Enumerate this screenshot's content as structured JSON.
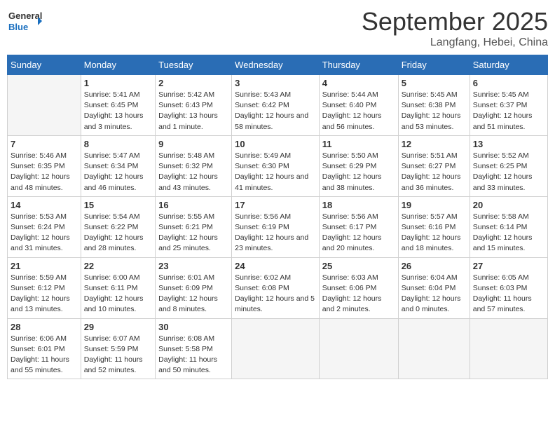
{
  "logo": {
    "text_general": "General",
    "text_blue": "Blue"
  },
  "title": "September 2025",
  "subtitle": "Langfang, Hebei, China",
  "weekdays": [
    "Sunday",
    "Monday",
    "Tuesday",
    "Wednesday",
    "Thursday",
    "Friday",
    "Saturday"
  ],
  "weeks": [
    [
      {
        "day": "",
        "info": ""
      },
      {
        "day": "1",
        "info": "Sunrise: 5:41 AM\nSunset: 6:45 PM\nDaylight: 13 hours\nand 3 minutes."
      },
      {
        "day": "2",
        "info": "Sunrise: 5:42 AM\nSunset: 6:43 PM\nDaylight: 13 hours\nand 1 minute."
      },
      {
        "day": "3",
        "info": "Sunrise: 5:43 AM\nSunset: 6:42 PM\nDaylight: 12 hours\nand 58 minutes."
      },
      {
        "day": "4",
        "info": "Sunrise: 5:44 AM\nSunset: 6:40 PM\nDaylight: 12 hours\nand 56 minutes."
      },
      {
        "day": "5",
        "info": "Sunrise: 5:45 AM\nSunset: 6:38 PM\nDaylight: 12 hours\nand 53 minutes."
      },
      {
        "day": "6",
        "info": "Sunrise: 5:45 AM\nSunset: 6:37 PM\nDaylight: 12 hours\nand 51 minutes."
      }
    ],
    [
      {
        "day": "7",
        "info": "Sunrise: 5:46 AM\nSunset: 6:35 PM\nDaylight: 12 hours\nand 48 minutes."
      },
      {
        "day": "8",
        "info": "Sunrise: 5:47 AM\nSunset: 6:34 PM\nDaylight: 12 hours\nand 46 minutes."
      },
      {
        "day": "9",
        "info": "Sunrise: 5:48 AM\nSunset: 6:32 PM\nDaylight: 12 hours\nand 43 minutes."
      },
      {
        "day": "10",
        "info": "Sunrise: 5:49 AM\nSunset: 6:30 PM\nDaylight: 12 hours\nand 41 minutes."
      },
      {
        "day": "11",
        "info": "Sunrise: 5:50 AM\nSunset: 6:29 PM\nDaylight: 12 hours\nand 38 minutes."
      },
      {
        "day": "12",
        "info": "Sunrise: 5:51 AM\nSunset: 6:27 PM\nDaylight: 12 hours\nand 36 minutes."
      },
      {
        "day": "13",
        "info": "Sunrise: 5:52 AM\nSunset: 6:25 PM\nDaylight: 12 hours\nand 33 minutes."
      }
    ],
    [
      {
        "day": "14",
        "info": "Sunrise: 5:53 AM\nSunset: 6:24 PM\nDaylight: 12 hours\nand 31 minutes."
      },
      {
        "day": "15",
        "info": "Sunrise: 5:54 AM\nSunset: 6:22 PM\nDaylight: 12 hours\nand 28 minutes."
      },
      {
        "day": "16",
        "info": "Sunrise: 5:55 AM\nSunset: 6:21 PM\nDaylight: 12 hours\nand 25 minutes."
      },
      {
        "day": "17",
        "info": "Sunrise: 5:56 AM\nSunset: 6:19 PM\nDaylight: 12 hours\nand 23 minutes."
      },
      {
        "day": "18",
        "info": "Sunrise: 5:56 AM\nSunset: 6:17 PM\nDaylight: 12 hours\nand 20 minutes."
      },
      {
        "day": "19",
        "info": "Sunrise: 5:57 AM\nSunset: 6:16 PM\nDaylight: 12 hours\nand 18 minutes."
      },
      {
        "day": "20",
        "info": "Sunrise: 5:58 AM\nSunset: 6:14 PM\nDaylight: 12 hours\nand 15 minutes."
      }
    ],
    [
      {
        "day": "21",
        "info": "Sunrise: 5:59 AM\nSunset: 6:12 PM\nDaylight: 12 hours\nand 13 minutes."
      },
      {
        "day": "22",
        "info": "Sunrise: 6:00 AM\nSunset: 6:11 PM\nDaylight: 12 hours\nand 10 minutes."
      },
      {
        "day": "23",
        "info": "Sunrise: 6:01 AM\nSunset: 6:09 PM\nDaylight: 12 hours\nand 8 minutes."
      },
      {
        "day": "24",
        "info": "Sunrise: 6:02 AM\nSunset: 6:08 PM\nDaylight: 12 hours\nand 5 minutes."
      },
      {
        "day": "25",
        "info": "Sunrise: 6:03 AM\nSunset: 6:06 PM\nDaylight: 12 hours\nand 2 minutes."
      },
      {
        "day": "26",
        "info": "Sunrise: 6:04 AM\nSunset: 6:04 PM\nDaylight: 12 hours\nand 0 minutes."
      },
      {
        "day": "27",
        "info": "Sunrise: 6:05 AM\nSunset: 6:03 PM\nDaylight: 11 hours\nand 57 minutes."
      }
    ],
    [
      {
        "day": "28",
        "info": "Sunrise: 6:06 AM\nSunset: 6:01 PM\nDaylight: 11 hours\nand 55 minutes."
      },
      {
        "day": "29",
        "info": "Sunrise: 6:07 AM\nSunset: 5:59 PM\nDaylight: 11 hours\nand 52 minutes."
      },
      {
        "day": "30",
        "info": "Sunrise: 6:08 AM\nSunset: 5:58 PM\nDaylight: 11 hours\nand 50 minutes."
      },
      {
        "day": "",
        "info": ""
      },
      {
        "day": "",
        "info": ""
      },
      {
        "day": "",
        "info": ""
      },
      {
        "day": "",
        "info": ""
      }
    ]
  ]
}
